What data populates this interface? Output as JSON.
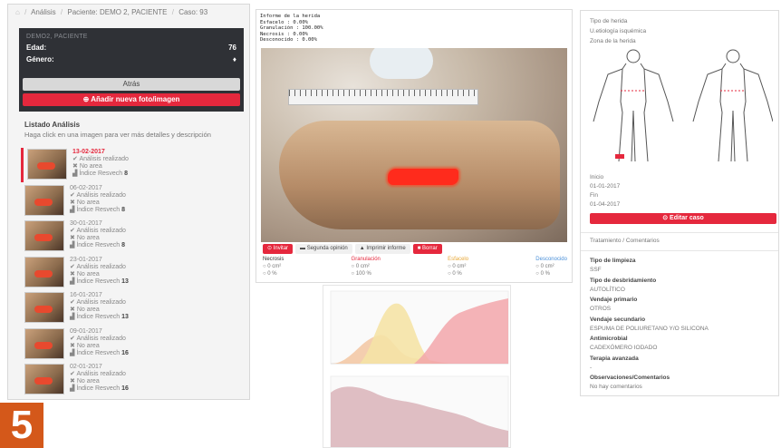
{
  "breadcrumb": [
    "Análisis",
    "Paciente: DEMO 2, PACIENTE",
    "Caso: 93"
  ],
  "patient": {
    "header": "DEMO2, PACIENTE",
    "age_label": "Edad:",
    "age_value": "76",
    "gender_label": "Género:",
    "gender_value": "♦",
    "back_button": "Atrás",
    "add_button": "Añadir nueva foto/imagen"
  },
  "list": {
    "title": "Listado Análisis",
    "help": "Haga click en una imagen para ver más detalles y descripción",
    "items": [
      {
        "date": "13-02-2017",
        "status": "Análisis realizado",
        "area": "No area",
        "index_label": "Índice Resvech",
        "index": "8"
      },
      {
        "date": "06-02-2017",
        "status": "Análisis realizado",
        "area": "No area",
        "index_label": "Índice Resvech",
        "index": "8"
      },
      {
        "date": "30-01-2017",
        "status": "Análisis realizado",
        "area": "No area",
        "index_label": "Índice Resvech",
        "index": "8"
      },
      {
        "date": "23-01-2017",
        "status": "Análisis realizado",
        "area": "No area",
        "index_label": "Índice Resvech",
        "index": "13"
      },
      {
        "date": "16-01-2017",
        "status": "Análisis realizado",
        "area": "No area",
        "index_label": "Índice Resvech",
        "index": "13"
      },
      {
        "date": "09-01-2017",
        "status": "Análisis realizado",
        "area": "No area",
        "index_label": "Índice Resvech",
        "index": "16"
      },
      {
        "date": "02-01-2017",
        "status": "Análisis realizado",
        "area": "No area",
        "index_label": "Índice Resvech",
        "index": "16"
      }
    ]
  },
  "report": {
    "lines": [
      "Informe de la herida",
      "Esfacelo  : 0.00%",
      "Granulación : 100.00%",
      "Necrosis  : 0.00%",
      "Desconocido : 0.00%"
    ]
  },
  "toolbar": {
    "invite": "Invitar",
    "second_opinion": "Segunda opinión",
    "print": "Imprimir informe",
    "delete": "Borrar"
  },
  "tissues": [
    {
      "name": "Necrosis",
      "area": "0 cm²",
      "pct": "0 %",
      "color": "#333333"
    },
    {
      "name": "Granulación",
      "area": "0 cm²",
      "pct": "100 %",
      "color": "#e5283d"
    },
    {
      "name": "Esfacelo",
      "area": "0 cm²",
      "pct": "0 %",
      "color": "#e8a838"
    },
    {
      "name": "Desconocido",
      "area": "0 cm²",
      "pct": "0 %",
      "color": "#4a90d9"
    }
  ],
  "case": {
    "wound_type_label": "Tipo de herida",
    "wound_type": "U.etiología isquémica",
    "zone_label": "Zona de la herida",
    "start_label": "Inicio",
    "start_date": "01-01-2017",
    "end_label": "Fin",
    "end_date": "01-04-2017",
    "edit_button": "Editar caso",
    "tabs": "Tratamiento / Comentarios"
  },
  "treatment": [
    {
      "label": "Tipo de limpieza",
      "value": "SSF"
    },
    {
      "label": "Tipo de desbridamiento",
      "value": "AUTOLÍTICO"
    },
    {
      "label": "Vendaje primario",
      "value": "OTROS"
    },
    {
      "label": "Vendaje secundario",
      "value": "ESPUMA DE POLIURETANO Y/O SILICONA"
    },
    {
      "label": "Antimicrobial",
      "value": "CADEXÓMERO IODADO"
    },
    {
      "label": "Terapia avanzada",
      "value": "-"
    },
    {
      "label": "Observaciones/Comentarios",
      "value": "No hay comentarios"
    }
  ],
  "figure_number": "5",
  "colors": {
    "accent": "#e5283d",
    "dark_panel": "#2f3136",
    "figure_label": "#d4581a"
  }
}
